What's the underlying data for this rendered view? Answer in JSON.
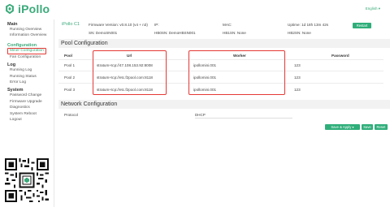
{
  "brand": {
    "name": "iPollo"
  },
  "header": {
    "language": "English"
  },
  "sidebar": {
    "sections": [
      {
        "title": "Main",
        "items": [
          "Running Overview",
          "Information Overview"
        ]
      },
      {
        "title": "Configuration",
        "items": [
          "Miner Configuration",
          "Fan Configuration"
        ]
      },
      {
        "title": "Log",
        "items": [
          "Running Log",
          "Running Status",
          "Error Log"
        ]
      },
      {
        "title": "System",
        "items": [
          "Password Change",
          "Firmware Upgrade",
          "Diagnostics",
          "System Reboot",
          "Logout"
        ]
      }
    ]
  },
  "info": {
    "model": "iPollo C1",
    "firmware": "Firmware Version: v0.8.10 (v4 + n3)",
    "ip": "IP:",
    "mac": "MAC:",
    "uptime": "Uptime: 1d 18h 13m 42s",
    "sn": "SN: DemoSN001",
    "hb0sn": "HB0SN: DemoHBSN001",
    "hb1sn": "HB1SN: None",
    "hb2sn": "HB2SN: None",
    "restart_label": "Restart"
  },
  "pool_config": {
    "title": "Pool Configuration",
    "columns": [
      "Pool",
      "Url",
      "Worker",
      "Password"
    ],
    "rows": [
      {
        "pool": "Pool 1",
        "url": "stratum+tcp://47.108.153.92:8008",
        "worker": "ipollomini.001",
        "password": "123"
      },
      {
        "pool": "Pool 2",
        "url": "stratum+tcp://etc.f2pool.com:8118",
        "worker": "ipollomini.001",
        "password": "123"
      },
      {
        "pool": "Pool 3",
        "url": "stratum+tcp://etc.f2pool.com:8118",
        "worker": "ipollomini.001",
        "password": "123"
      }
    ]
  },
  "network_config": {
    "title": "Network Configuration",
    "protocol_label": "Protocol",
    "protocol_value": "DHCP"
  },
  "actions": {
    "save_apply": "Save & Apply",
    "save": "Save",
    "reset": "Reset"
  },
  "colors": {
    "accent": "#2fae7a",
    "highlight_box": "#e53935"
  }
}
